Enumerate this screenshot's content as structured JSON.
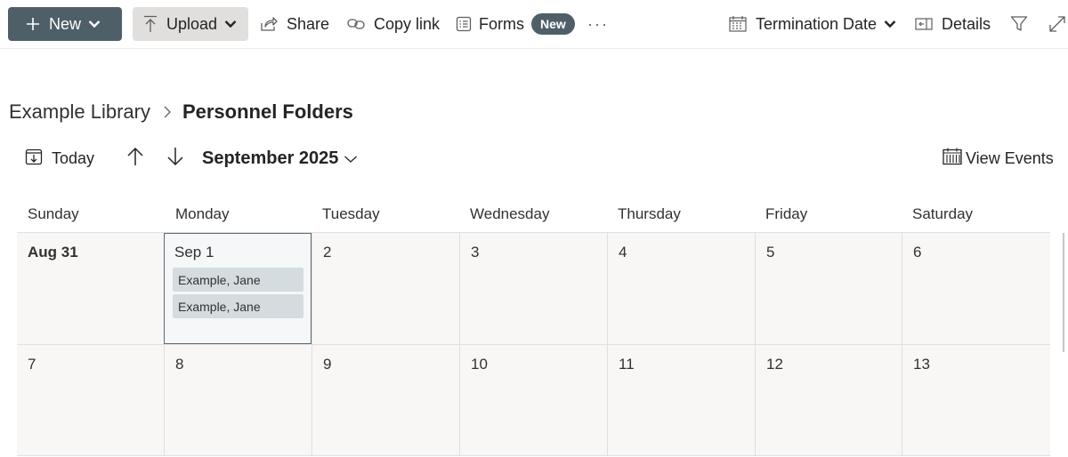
{
  "command_bar": {
    "new_label": "New",
    "upload_label": "Upload",
    "share_label": "Share",
    "copy_link_label": "Copy link",
    "forms_label": "Forms",
    "forms_badge": "New",
    "more_label": "···",
    "view_selector_label": "Termination Date",
    "details_label": "Details",
    "icons": [
      "plus-icon",
      "chevron-down-icon",
      "upload-arrow-icon",
      "share-icon",
      "link-icon",
      "forms-icon",
      "calendar-view-icon",
      "details-panel-icon",
      "filter-icon",
      "expand-icon"
    ]
  },
  "breadcrumb": {
    "parent": "Example Library",
    "current": "Personnel Folders"
  },
  "calendar_toolbar": {
    "today_label": "Today",
    "month_label": "September 2025",
    "view_events_label": "View Events"
  },
  "calendar": {
    "weekdays": [
      "Sunday",
      "Monday",
      "Tuesday",
      "Wednesday",
      "Thursday",
      "Friday",
      "Saturday"
    ],
    "weeks": [
      [
        {
          "label": "Aug 31",
          "events": []
        },
        {
          "label": "Sep 1",
          "events": [
            "Example, Jane",
            "Example, Jane"
          ],
          "selected": true
        },
        {
          "label": "2",
          "events": []
        },
        {
          "label": "3",
          "events": []
        },
        {
          "label": "4",
          "events": []
        },
        {
          "label": "5",
          "events": []
        },
        {
          "label": "6",
          "events": []
        }
      ],
      [
        {
          "label": "7",
          "events": []
        },
        {
          "label": "8",
          "events": []
        },
        {
          "label": "9",
          "events": []
        },
        {
          "label": "10",
          "events": []
        },
        {
          "label": "11",
          "events": []
        },
        {
          "label": "12",
          "events": []
        },
        {
          "label": "13",
          "events": []
        }
      ]
    ]
  },
  "colors": {
    "primary_button": "#4e5f68",
    "selected_border": "#5b6b74",
    "event_fill": "#d5dce0",
    "grid_background": "#f8f7f6"
  }
}
